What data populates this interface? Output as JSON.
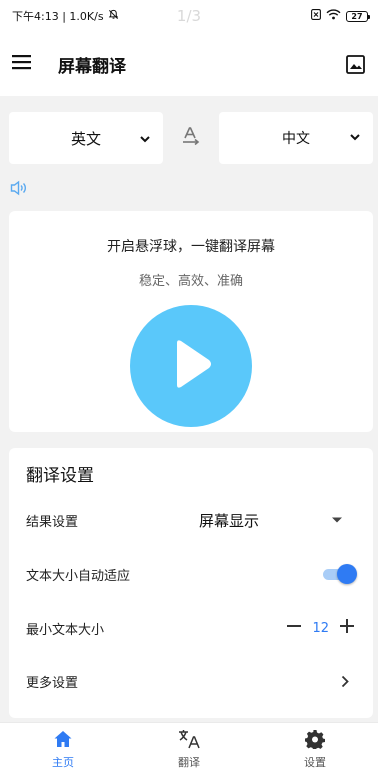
{
  "status_bar": {
    "time_speed": "下午4:13 | 1.0K/s",
    "page_indicator": "1/3",
    "battery": "27"
  },
  "app_bar": {
    "title": "屏幕翻译"
  },
  "languages": {
    "source": "英文",
    "target": "中文"
  },
  "main_card": {
    "headline": "开启悬浮球，一键翻译屏幕",
    "subtitle": "稳定、高效、准确"
  },
  "settings": {
    "title": "翻译设置",
    "result_label": "结果设置",
    "result_value": "屏幕显示",
    "auto_size_label": "文本大小自动适应",
    "auto_size_enabled": true,
    "min_size_label": "最小文本大小",
    "min_size_value": "12",
    "more_label": "更多设置"
  },
  "bottom_nav": {
    "items": [
      {
        "label": "主页",
        "icon": "home-icon",
        "active": true
      },
      {
        "label": "翻译",
        "icon": "translate-icon",
        "active": false
      },
      {
        "label": "设置",
        "icon": "gear-icon",
        "active": false
      }
    ]
  },
  "colors": {
    "accent": "#2f7bf3",
    "play_button": "#5ac8fa",
    "background": "#f2f2f2"
  }
}
